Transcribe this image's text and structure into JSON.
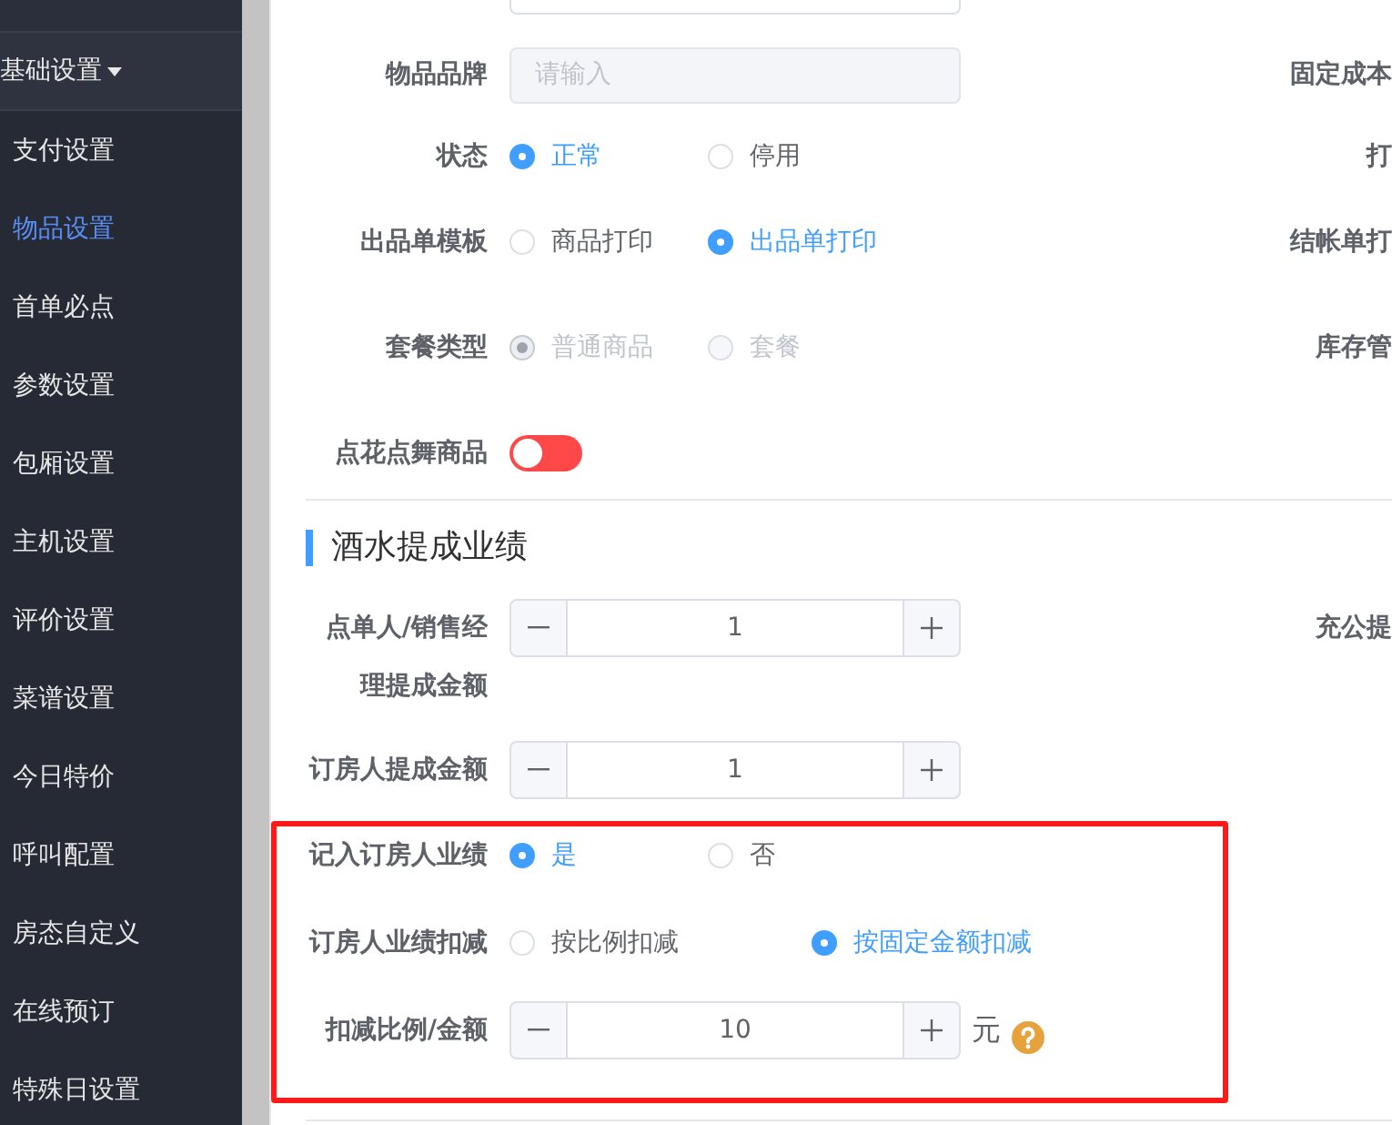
{
  "sidebar": {
    "group": {
      "label": "基础设置",
      "expanded": true
    },
    "items": [
      {
        "label": "支付设置",
        "selected": false
      },
      {
        "label": "物品设置",
        "selected": true
      },
      {
        "label": "首单必点",
        "selected": false
      },
      {
        "label": "参数设置",
        "selected": false
      },
      {
        "label": "包厢设置",
        "selected": false
      },
      {
        "label": "主机设置",
        "selected": false
      },
      {
        "label": "评价设置",
        "selected": false
      },
      {
        "label": "菜谱设置",
        "selected": false
      },
      {
        "label": "今日特价",
        "selected": false
      },
      {
        "label": "呼叫配置",
        "selected": false
      },
      {
        "label": "房态自定义",
        "selected": false
      },
      {
        "label": "在线预订",
        "selected": false
      },
      {
        "label": "特殊日设置",
        "selected": false
      }
    ]
  },
  "form": {
    "rows": [
      {
        "kind": "input",
        "label": "物品品牌",
        "placeholder": "请输入",
        "disabled": true,
        "right_label": "固定成本"
      },
      {
        "kind": "radio",
        "label": "状态",
        "disabled": false,
        "options": [
          {
            "label": "正常",
            "selected": true
          },
          {
            "label": "停用",
            "selected": false
          }
        ],
        "right_label": "打"
      },
      {
        "kind": "radio",
        "label": "出品单模板",
        "disabled": false,
        "options": [
          {
            "label": "商品打印",
            "selected": false
          },
          {
            "label": "出品单打印",
            "selected": true
          }
        ],
        "right_label": "结帐单打"
      },
      {
        "kind": "radio",
        "label": "套餐类型",
        "disabled": true,
        "options": [
          {
            "label": "普通商品",
            "selected": true
          },
          {
            "label": "套餐",
            "selected": false
          }
        ],
        "right_label": "库存管"
      },
      {
        "kind": "switch",
        "label": "点花点舞商品",
        "disabled": false,
        "on": false
      }
    ]
  },
  "commission": {
    "title": "酒水提成业绩",
    "rows": [
      {
        "kind": "number",
        "label": "点单人/销售经理提成金额",
        "disabled": false,
        "value": "1",
        "right_label": "充公提"
      },
      {
        "kind": "number",
        "label": "订房人提成金额",
        "disabled": false,
        "value": "1"
      }
    ],
    "highlighted_rows": [
      {
        "kind": "radio",
        "label": "记入订房人业绩",
        "disabled": false,
        "options": [
          {
            "label": "是",
            "selected": true
          },
          {
            "label": "否",
            "selected": false
          }
        ]
      },
      {
        "kind": "radio",
        "label": "订房人业绩扣减",
        "disabled": false,
        "options": [
          {
            "label": "按比例扣减",
            "selected": false
          },
          {
            "label": "按固定金额扣减",
            "selected": true
          }
        ]
      },
      {
        "kind": "number",
        "label": "扣减比例/金额",
        "disabled": false,
        "value": "10",
        "unit": "元",
        "help": true
      }
    ]
  }
}
